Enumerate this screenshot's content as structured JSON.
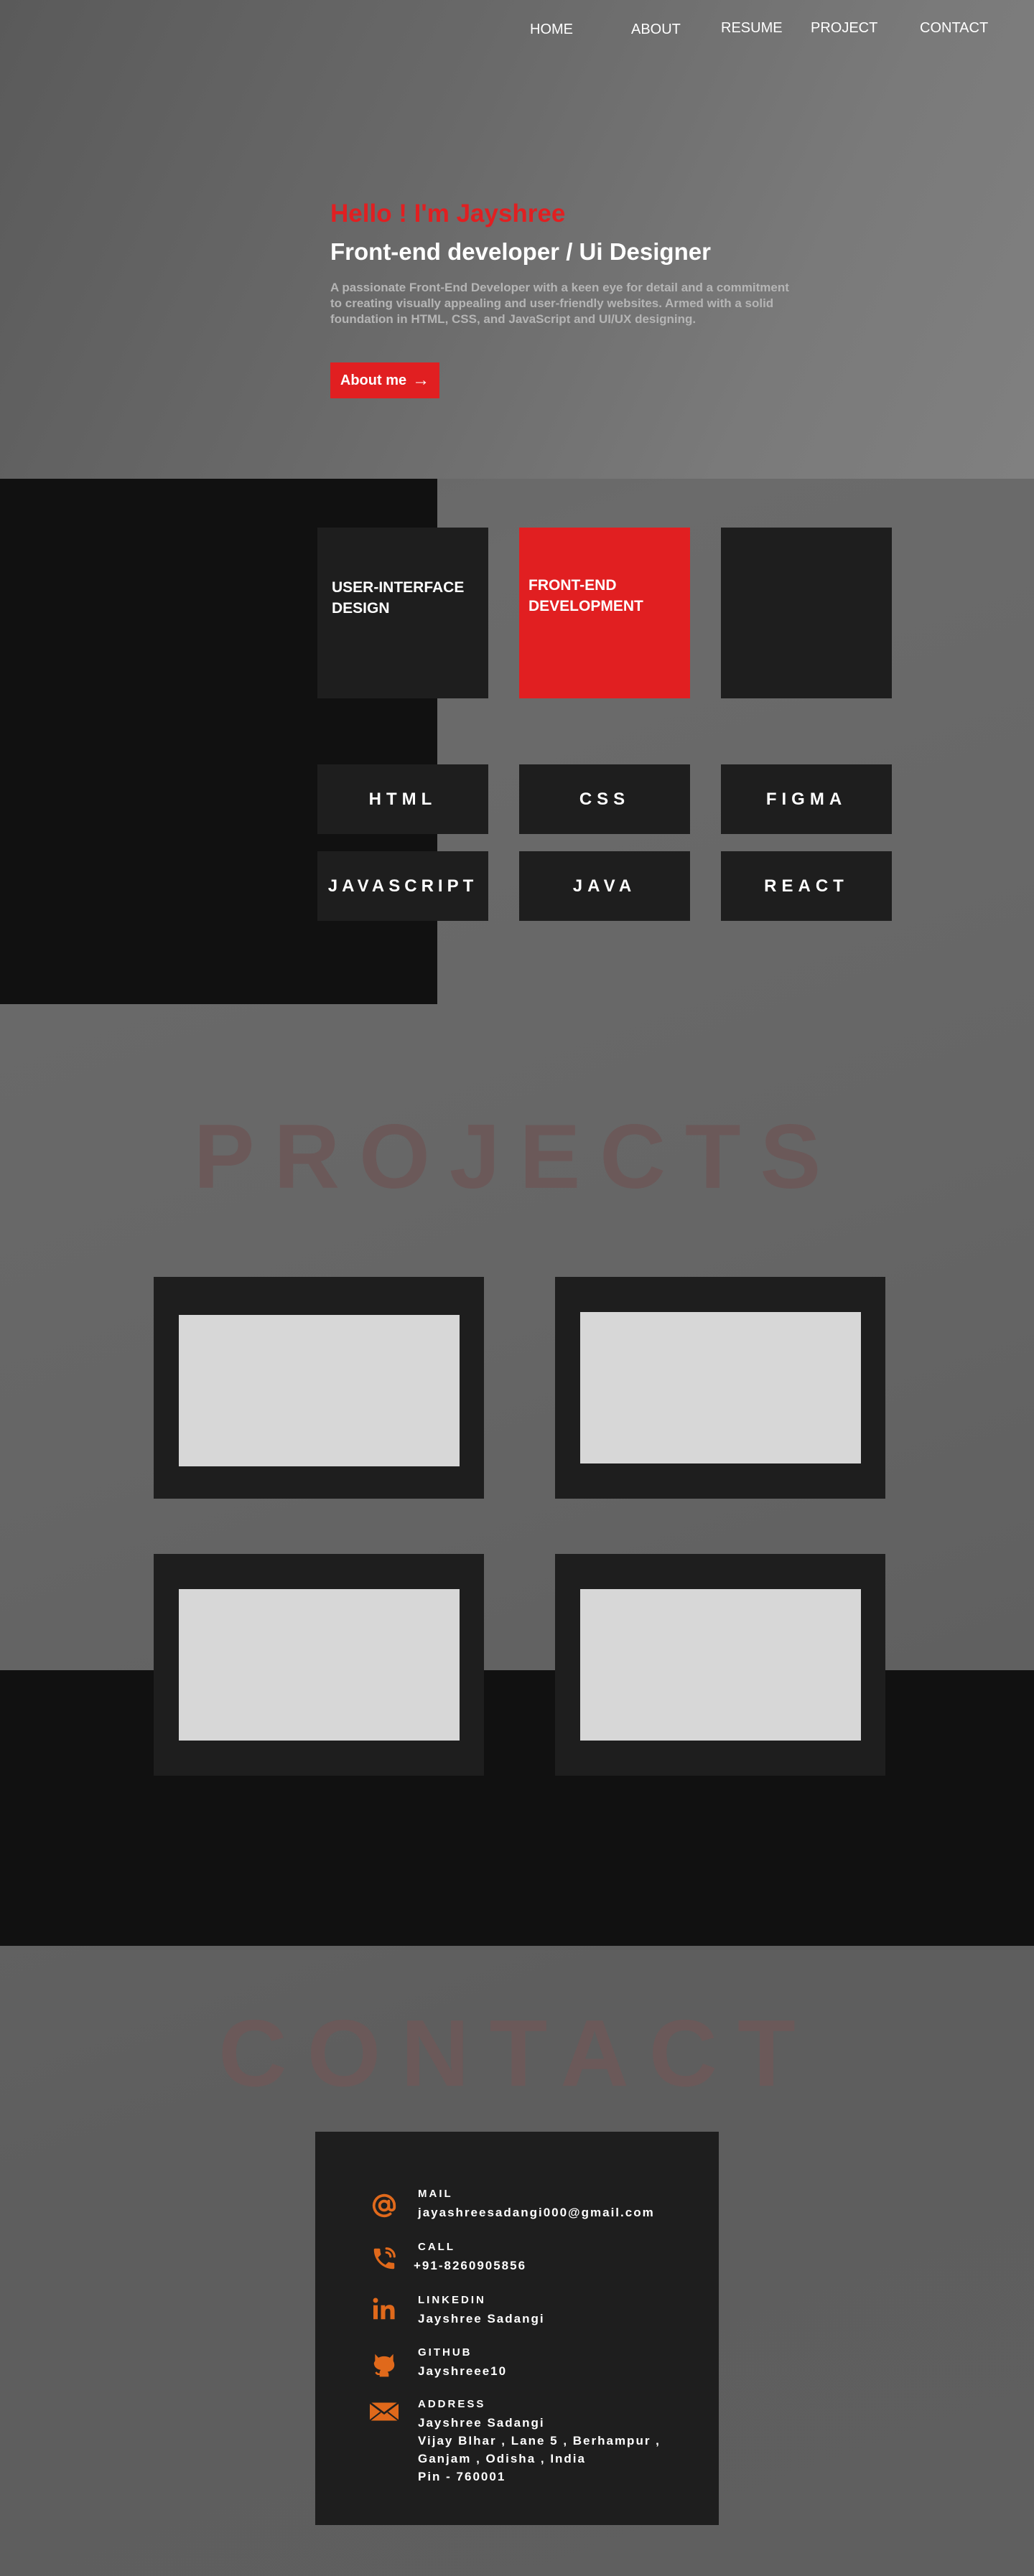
{
  "nav": [
    "HOME",
    "ABOUT",
    "RESUME",
    "PROJECT",
    "CONTACT"
  ],
  "hero": {
    "greeting": "Hello ! I'm Jayshree",
    "role": "Front-end developer / Ui Designer",
    "intro": "A passionate Front-End Developer with a keen eye for detail and a commitment to creating visually appealing and user-friendly websites. Armed with a solid foundation in HTML, CSS, and JavaScript and UI/UX designing.",
    "button_label": "About me",
    "button_arrow": "→"
  },
  "services": [
    "USER-INTERFACE DESIGN",
    "FRONT-END DEVELOPMENT",
    ""
  ],
  "skills": [
    "HTML",
    "CSS",
    "FIGMA",
    "JAVASCRIPT",
    "JAVA",
    "REACT"
  ],
  "projects": {
    "title": "PROJECTS",
    "count": 4
  },
  "contact": {
    "title": "CONTACT",
    "items": [
      {
        "label": "MAIL",
        "value": "jayashreesadangi000@gmail.com",
        "icon": "at-icon"
      },
      {
        "label": "CALL",
        "value": "+91-8260905856",
        "icon": "phone-icon"
      },
      {
        "label": "LINKEDIN",
        "value": "Jayshree Sadangi",
        "icon": "linkedin-icon"
      },
      {
        "label": "GITHUB",
        "value": "Jayshreee10",
        "icon": "github-icon"
      },
      {
        "label": "ADDRESS",
        "value_lines": [
          "Jayshree Sadangi",
          "Vijay BIhar , Lane 5 , Berhampur ,",
          "Ganjam , Odisha , India",
          "Pin - 760001"
        ],
        "icon": "mail-envelope-icon"
      }
    ]
  },
  "colors": {
    "accent": "#e11f21",
    "icon": "#e0691b",
    "panel": "#1e1e1e",
    "dark": "#111111"
  }
}
